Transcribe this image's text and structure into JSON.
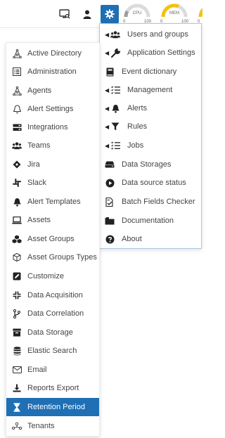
{
  "gauges": [
    {
      "label": "CPU",
      "min": "0",
      "max": "100"
    },
    {
      "label": "MEM",
      "min": "0",
      "max": "100"
    },
    {
      "label": "",
      "min": "0",
      "max": ""
    }
  ],
  "colors": {
    "accent": "#1f6fb5",
    "gauge_cpu": "#9e9e9e",
    "gauge_mem": "#f4c20d"
  },
  "settings_menu": [
    {
      "label": "Users and groups",
      "icon": "users-icon",
      "submenu": true
    },
    {
      "label": "Application Settings",
      "icon": "wrench-icon",
      "submenu": true
    },
    {
      "label": "Event dictionary",
      "icon": "book-icon",
      "submenu": false
    },
    {
      "label": "Management",
      "icon": "list-check-icon",
      "submenu": true
    },
    {
      "label": "Alerts",
      "icon": "bell-icon",
      "submenu": true
    },
    {
      "label": "Rules",
      "icon": "filter-icon",
      "submenu": true
    },
    {
      "label": "Jobs",
      "icon": "list-check-icon",
      "submenu": true
    },
    {
      "label": "Data Storages",
      "icon": "hdd-icon",
      "submenu": false
    },
    {
      "label": "Data source status",
      "icon": "play-circle-icon",
      "submenu": false
    },
    {
      "label": "Batch Fields Checker",
      "icon": "file-check-icon",
      "submenu": false
    },
    {
      "label": "Documentation",
      "icon": "folder-icon",
      "submenu": false
    },
    {
      "label": "About",
      "icon": "question-circle-icon",
      "submenu": false
    }
  ],
  "management_menu": [
    {
      "label": "Active Directory",
      "icon": "sitemap-icon"
    },
    {
      "label": "Administration",
      "icon": "list-box-icon"
    },
    {
      "label": "Agents",
      "icon": "sitemap-icon"
    },
    {
      "label": "Alert Settings",
      "icon": "bell-outline-icon"
    },
    {
      "label": "Integrations",
      "icon": "server-icon"
    },
    {
      "label": "Teams",
      "icon": "users-icon"
    },
    {
      "label": "Jira",
      "icon": "diamond-icon"
    },
    {
      "label": "Slack",
      "icon": "slack-icon"
    },
    {
      "label": "Alert Templates",
      "icon": "bell-icon"
    },
    {
      "label": "Assets",
      "icon": "laptop-icon"
    },
    {
      "label": "Asset Groups",
      "icon": "cubes-icon"
    },
    {
      "label": "Asset Groups Types",
      "icon": "cube-icon"
    },
    {
      "label": "Customize",
      "icon": "edit-icon"
    },
    {
      "label": "Data Acquisition",
      "icon": "compress-icon"
    },
    {
      "label": "Data Correlation",
      "icon": "branch-icon"
    },
    {
      "label": "Data Storage",
      "icon": "archive-icon"
    },
    {
      "label": "Elastic Search",
      "icon": "database-icon"
    },
    {
      "label": "Email",
      "icon": "envelope-icon"
    },
    {
      "label": "Reports Export",
      "icon": "download-icon"
    },
    {
      "label": "Retention Period",
      "icon": "hourglass-icon",
      "active": true
    },
    {
      "label": "Tenants",
      "icon": "tenants-icon"
    }
  ]
}
